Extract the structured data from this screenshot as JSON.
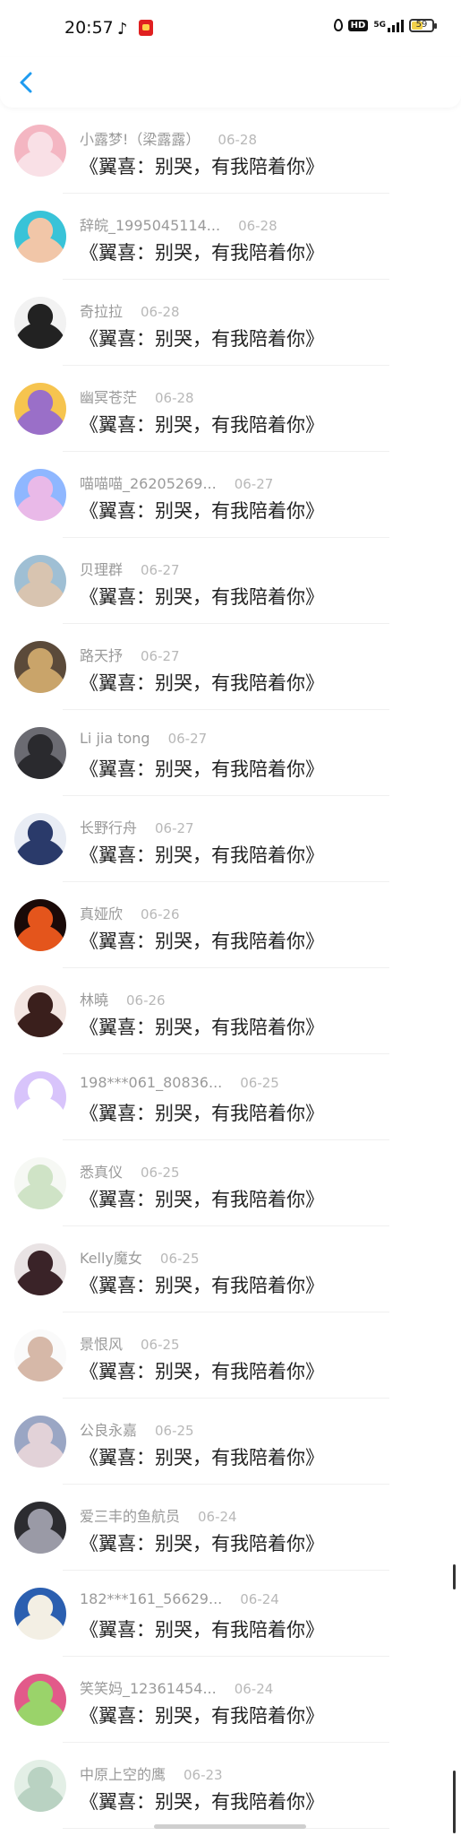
{
  "status_bar": {
    "time": "20:57",
    "network": "5G",
    "hd": "HD",
    "battery": "59",
    "battery_level": 0.59
  },
  "nav": {
    "back_icon": "chevron-left-icon",
    "accent": "#1e9bf0"
  },
  "comments": [
    {
      "name": "小露梦!（梁露露）",
      "date": "06-28",
      "work": "《翼喜：别哭，有我陪着你》",
      "avatar_colors": [
        "#f4b6c2",
        "#f9e0e6"
      ]
    },
    {
      "name": "辞皖_1995045114...",
      "date": "06-28",
      "work": "《翼喜：别哭，有我陪着你》",
      "avatar_colors": [
        "#39c3d8",
        "#f1c6a8"
      ]
    },
    {
      "name": "奇拉拉",
      "date": "06-28",
      "work": "《翼喜：别哭，有我陪着你》",
      "avatar_colors": [
        "#f2f2f2",
        "#222222"
      ]
    },
    {
      "name": "幽冥苍茫",
      "date": "06-28",
      "work": "《翼喜：别哭，有我陪着你》",
      "avatar_colors": [
        "#f6c44f",
        "#9a6fc8"
      ]
    },
    {
      "name": "喵喵喵_26205269...",
      "date": "06-27",
      "work": "《翼喜：别哭，有我陪着你》",
      "avatar_colors": [
        "#8fb7ff",
        "#e9b9e8"
      ]
    },
    {
      "name": "贝理群",
      "date": "06-27",
      "work": "《翼喜：别哭，有我陪着你》",
      "avatar_colors": [
        "#9fbfd4",
        "#d8c4b0"
      ]
    },
    {
      "name": "路天抒",
      "date": "06-27",
      "work": "《翼喜：别哭，有我陪着你》",
      "avatar_colors": [
        "#5b4a3a",
        "#c9a46a"
      ]
    },
    {
      "name": "Li jia tong",
      "date": "06-27",
      "work": "《翼喜：别哭，有我陪着你》",
      "avatar_colors": [
        "#6b6b72",
        "#2a2a2e"
      ]
    },
    {
      "name": "长野行舟",
      "date": "06-27",
      "work": "《翼喜：别哭，有我陪着你》",
      "avatar_colors": [
        "#e8ecf4",
        "#2a3a6a"
      ]
    },
    {
      "name": "真娅欣",
      "date": "06-26",
      "work": "《翼喜：别哭，有我陪着你》",
      "avatar_colors": [
        "#1a0a08",
        "#e4551c"
      ]
    },
    {
      "name": "林曉",
      "date": "06-26",
      "work": "《翼喜：别哭，有我陪着你》",
      "avatar_colors": [
        "#f3e6e2",
        "#3a1f1c"
      ]
    },
    {
      "name": "198***061_80836...",
      "date": "06-25",
      "work": "《翼喜：别哭，有我陪着你》",
      "avatar_colors": [
        "#d8c4fb",
        "#ffffff"
      ]
    },
    {
      "name": "悉真仪",
      "date": "06-25",
      "work": "《翼喜：别哭，有我陪着你》",
      "avatar_colors": [
        "#f6f8f4",
        "#cfe3c6"
      ]
    },
    {
      "name": "Kelly魔女",
      "date": "06-25",
      "work": "《翼喜：别哭，有我陪着你》",
      "avatar_colors": [
        "#e9e3e4",
        "#3a2328"
      ]
    },
    {
      "name": "景恨风",
      "date": "06-25",
      "work": "《翼喜：别哭，有我陪着你》",
      "avatar_colors": [
        "#fafafa",
        "#d6b8a8"
      ]
    },
    {
      "name": "公良永嘉",
      "date": "06-25",
      "work": "《翼喜：别哭，有我陪着你》",
      "avatar_colors": [
        "#9aa6c4",
        "#e2d2d8"
      ]
    },
    {
      "name": "爱三丰的鱼航员",
      "date": "06-24",
      "work": "《翼喜：别哭，有我陪着你》",
      "avatar_colors": [
        "#2c2c30",
        "#9a9aa6"
      ]
    },
    {
      "name": "182***161_56629...",
      "date": "06-24",
      "work": "《翼喜：别哭，有我陪着你》",
      "avatar_colors": [
        "#2b5fb0",
        "#f3efe4"
      ]
    },
    {
      "name": "笑笑妈_12361454...",
      "date": "06-24",
      "work": "《翼喜：别哭，有我陪着你》",
      "avatar_colors": [
        "#e25a8a",
        "#9ad36a"
      ]
    },
    {
      "name": "中原上空的鹰",
      "date": "06-23",
      "work": "《翼喜：别哭，有我陪着你》",
      "avatar_colors": [
        "#e3efe6",
        "#b9d2c2"
      ]
    }
  ]
}
